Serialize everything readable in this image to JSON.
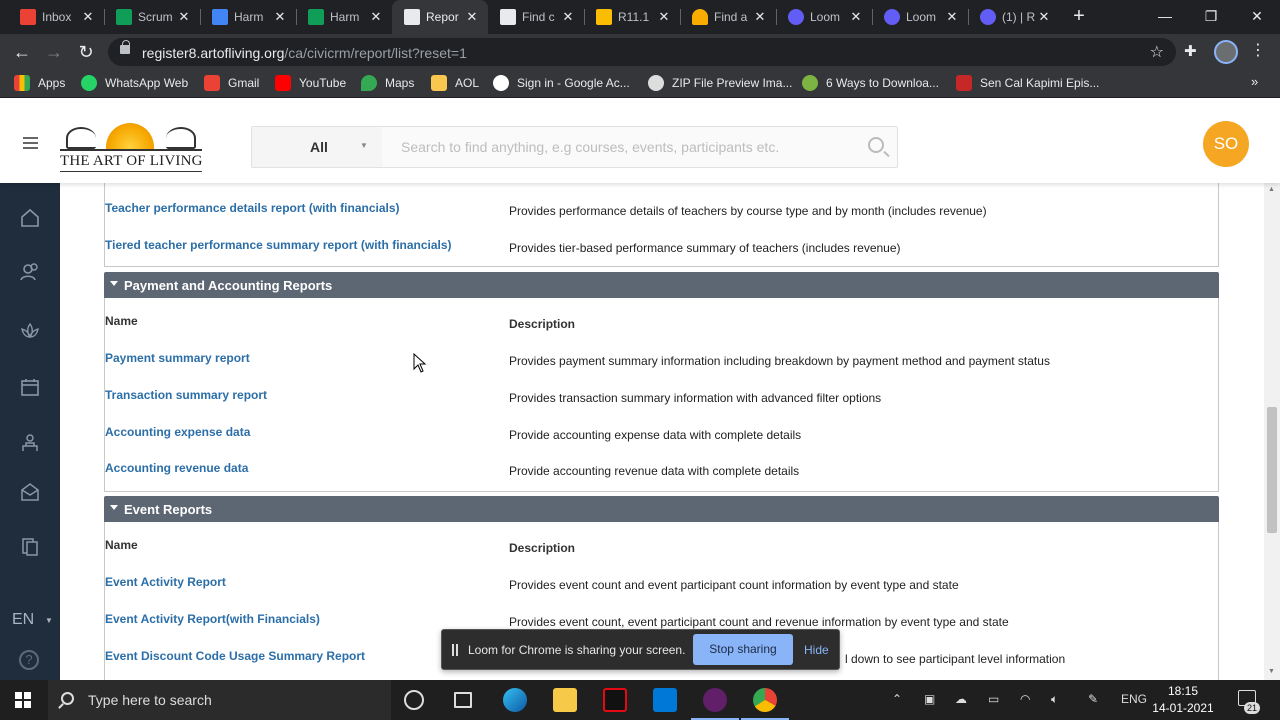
{
  "browser": {
    "tabs": [
      {
        "title": "Inbox",
        "favicon_color": "#ea4335",
        "active": false
      },
      {
        "title": "Scrum",
        "favicon_color": "#0f9d58",
        "active": false
      },
      {
        "title": "Harm",
        "favicon_color": "#4285f4",
        "active": false
      },
      {
        "title": "Harm",
        "favicon_color": "#0f9d58",
        "active": false
      },
      {
        "title": "Repor",
        "favicon_color": "#e8eaed",
        "active": true
      },
      {
        "title": "Find c",
        "favicon_color": "#e8eaed",
        "active": false
      },
      {
        "title": "R11.1",
        "favicon_color": "#fbbc04",
        "active": false
      },
      {
        "title": "Find a",
        "favicon_color": "#f9ab00",
        "active": false
      },
      {
        "title": "Loom",
        "favicon_color": "#625df5",
        "active": false
      },
      {
        "title": "Loom",
        "favicon_color": "#625df5",
        "active": false
      },
      {
        "title": "(1) | R",
        "favicon_color": "#625df5",
        "active": false
      }
    ],
    "url_host": "register8.artofliving.org",
    "url_path": "/ca/civicrm/report/list?reset=1",
    "bookmarks": [
      {
        "label": "Apps",
        "color": "#ea4335"
      },
      {
        "label": "WhatsApp Web",
        "color": "#25d366"
      },
      {
        "label": "Gmail",
        "color": "#ea4335"
      },
      {
        "label": "YouTube",
        "color": "#ff0000"
      },
      {
        "label": "Maps",
        "color": "#34a853"
      },
      {
        "label": "AOL",
        "color": "#f9c74f"
      },
      {
        "label": "Sign in - Google Ac...",
        "color": "#ffffff"
      },
      {
        "label": "ZIP File Preview Ima...",
        "color": "#dddddd"
      },
      {
        "label": "6 Ways to Downloa...",
        "color": "#7cb342"
      },
      {
        "label": "Sen Cal Kapimi Epis...",
        "color": "#c62828"
      }
    ]
  },
  "site": {
    "logo_text": "THE ART OF LIVING",
    "search_scope": "All",
    "search_placeholder": "Search to find anything, e.g courses, events, participants etc.",
    "avatar_initials": "SO",
    "language": "EN",
    "help": "?"
  },
  "reports": {
    "top_rows": [
      {
        "name": "Teacher performance details report (with financials)",
        "description": "Provides performance details of teachers by course type and by month (includes revenue)"
      },
      {
        "name": "Tiered teacher performance summary report (with financials)",
        "description": "Provides tier-based performance summary of teachers (includes revenue)"
      }
    ],
    "sections": [
      {
        "title": "Payment and Accounting Reports",
        "col_name": "Name",
        "col_desc": "Description",
        "rows": [
          {
            "name": "Payment summary report",
            "description": "Provides payment summary information including breakdown by payment method and payment status"
          },
          {
            "name": "Transaction summary report",
            "description": "Provides transaction summary information with advanced filter options"
          },
          {
            "name": "Accounting expense data",
            "description": "Provide accounting expense data with complete details"
          },
          {
            "name": "Accounting revenue data",
            "description": "Provide accounting revenue data with complete details"
          }
        ]
      },
      {
        "title": "Event Reports",
        "col_name": "Name",
        "col_desc": "Description",
        "rows": [
          {
            "name": "Event Activity Report",
            "description": "Provides event count and event participant count information by event type and state"
          },
          {
            "name": "Event Activity Report(with Financials)",
            "description": "Provides event count, event participant count and revenue information by event type and state"
          },
          {
            "name": "Event Discount Code Usage Summary Report",
            "description": "l down to see participant level information"
          }
        ]
      }
    ]
  },
  "loom": {
    "message": "Loom for Chrome is sharing your screen.",
    "stop_label": "Stop sharing",
    "hide_label": "Hide"
  },
  "taskbar": {
    "search_placeholder": "Type here to search",
    "language": "ENG",
    "time": "18:15",
    "date": "14-01-2021",
    "notification_count": "21"
  }
}
